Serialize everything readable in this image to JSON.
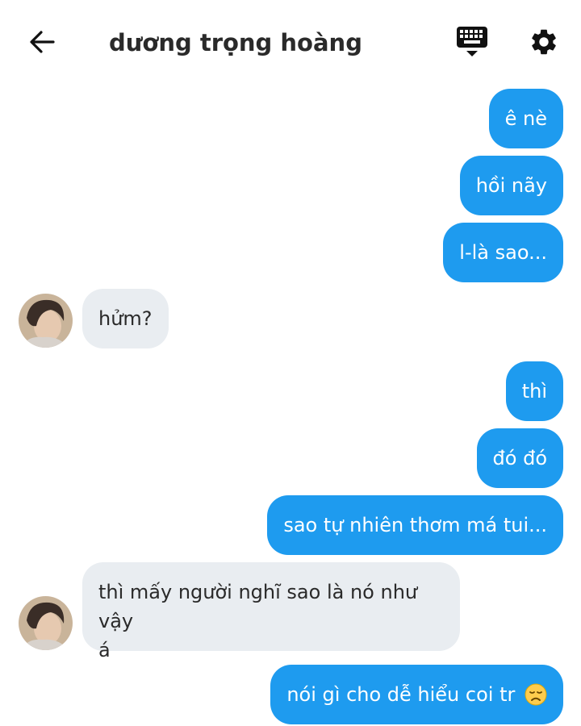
{
  "header": {
    "contact_name": "dương trọng hoàng",
    "back_icon": "arrow-left-icon",
    "keyboard_icon": "keyboard-icon",
    "settings_icon": "gear-icon"
  },
  "colors": {
    "outgoing_bubble": "#1e9bef",
    "incoming_bubble": "#e9edf1",
    "background": "#ffffff"
  },
  "messages": [
    {
      "side": "outgoing",
      "text": "ê nè"
    },
    {
      "side": "outgoing",
      "text": "hồi nãy"
    },
    {
      "side": "outgoing",
      "text": "l-là sao..."
    },
    {
      "side": "incoming",
      "text": "hửm?"
    },
    {
      "side": "outgoing",
      "text": "thì"
    },
    {
      "side": "outgoing",
      "text": "đó đó"
    },
    {
      "side": "outgoing",
      "text": "sao tự nhiên thơm má tui..."
    },
    {
      "side": "incoming",
      "text_line1": "thì mấy người nghĩ sao là nó như vậy",
      "text_line2": "á"
    },
    {
      "side": "outgoing",
      "text": "nói gì cho dễ hiểu coi tr",
      "emoji": "disappointed-face-icon"
    }
  ]
}
